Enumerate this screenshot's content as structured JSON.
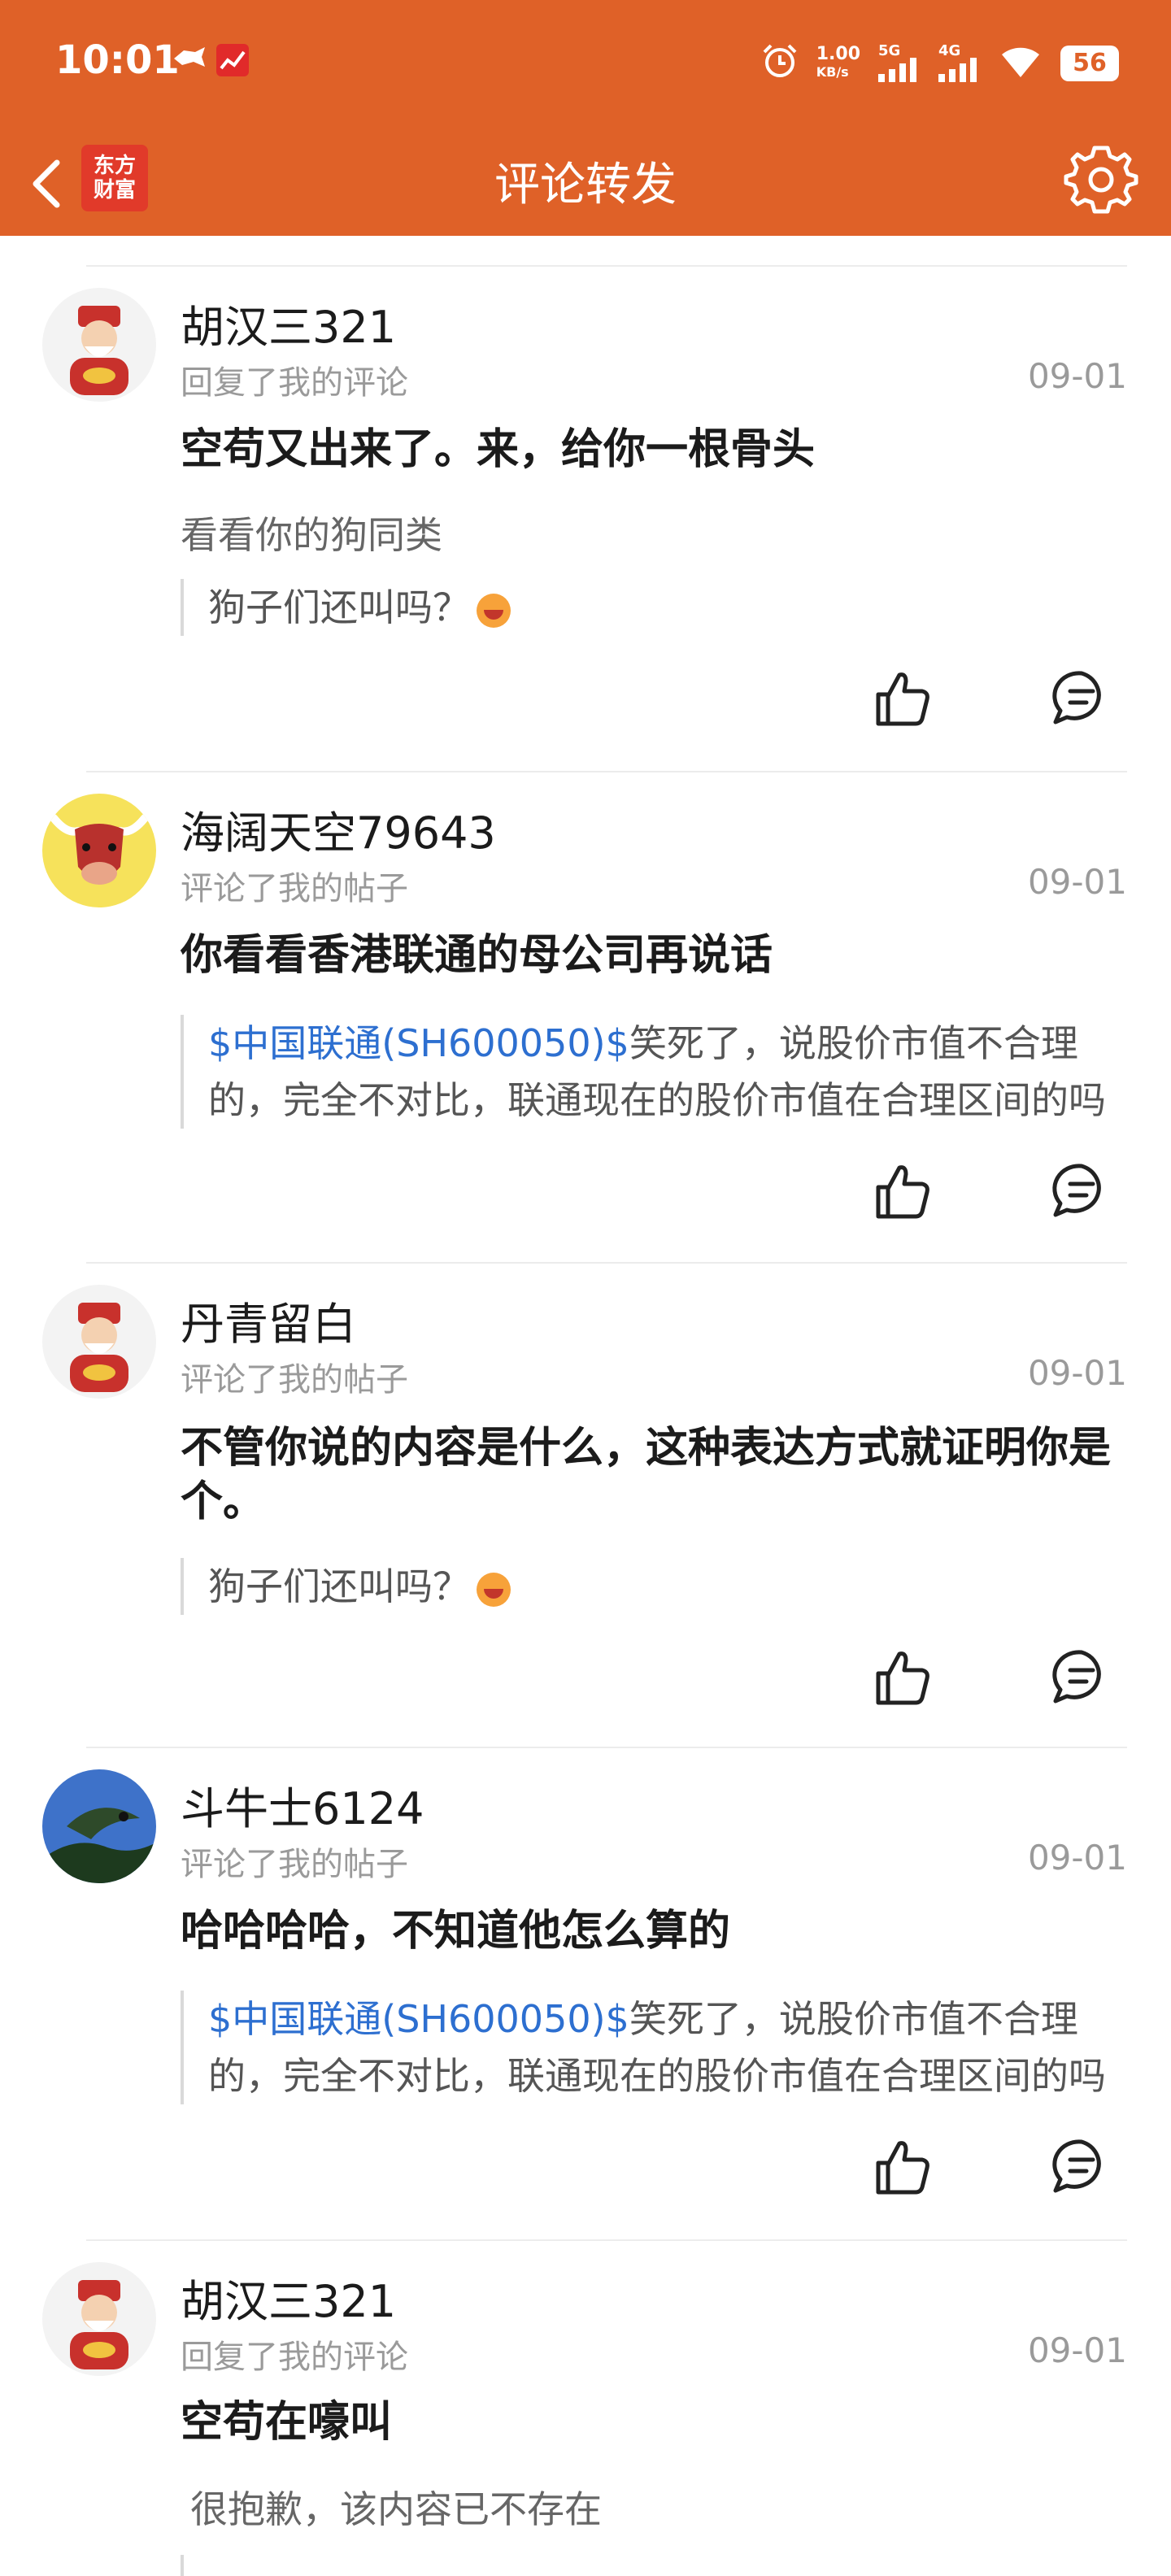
{
  "status": {
    "time": "10:01",
    "speed": "1.00",
    "speed_unit": "KB/s",
    "net1": "5G",
    "net2": "4G",
    "battery": "56"
  },
  "nav": {
    "title": "评论转发",
    "logo_line1": "东方",
    "logo_line2": "财富"
  },
  "colors": {
    "brand": "#df6128",
    "link": "#2d6fd0"
  },
  "comments": [
    {
      "user": "胡汉三321",
      "action": "回复了我的评论",
      "date": "09-01",
      "text": "空苟又出来了。来，给你一根骨头",
      "sub": "看看你的狗同类",
      "quote": "狗子们还叫吗？",
      "avatar": "caishen-avatar"
    },
    {
      "user": "海阔天空79643",
      "action": "评论了我的帖子",
      "date": "09-01",
      "text": "你看看香港联通的母公司再说话",
      "quote_stock": "$中国联通(SH600050)$",
      "quote": "笑死了，说股价市值不合理的，完全不对比，联通现在的股价市值在合理区间的吗",
      "avatar": "bull-avatar"
    },
    {
      "user": "丹青留白",
      "action": "评论了我的帖子",
      "date": "09-01",
      "text": "不管你说的内容是什么，这种表达方式就证明你是个。",
      "quote": "狗子们还叫吗？",
      "avatar": "caishen-avatar"
    },
    {
      "user": "斗牛士6124",
      "action": "评论了我的帖子",
      "date": "09-01",
      "text": "哈哈哈哈，不知道他怎么算的",
      "quote_stock": "$中国联通(SH600050)$",
      "quote": "笑死了，说股价市值不合理的，完全不对比，联通现在的股价市值在合理区间的吗",
      "avatar": "bird-avatar"
    },
    {
      "user": "胡汉三321",
      "action": "回复了我的评论",
      "date": "09-01",
      "text": "空苟在嚎叫",
      "sub": "很抱歉，该内容已不存在",
      "avatar": "caishen-avatar"
    }
  ]
}
